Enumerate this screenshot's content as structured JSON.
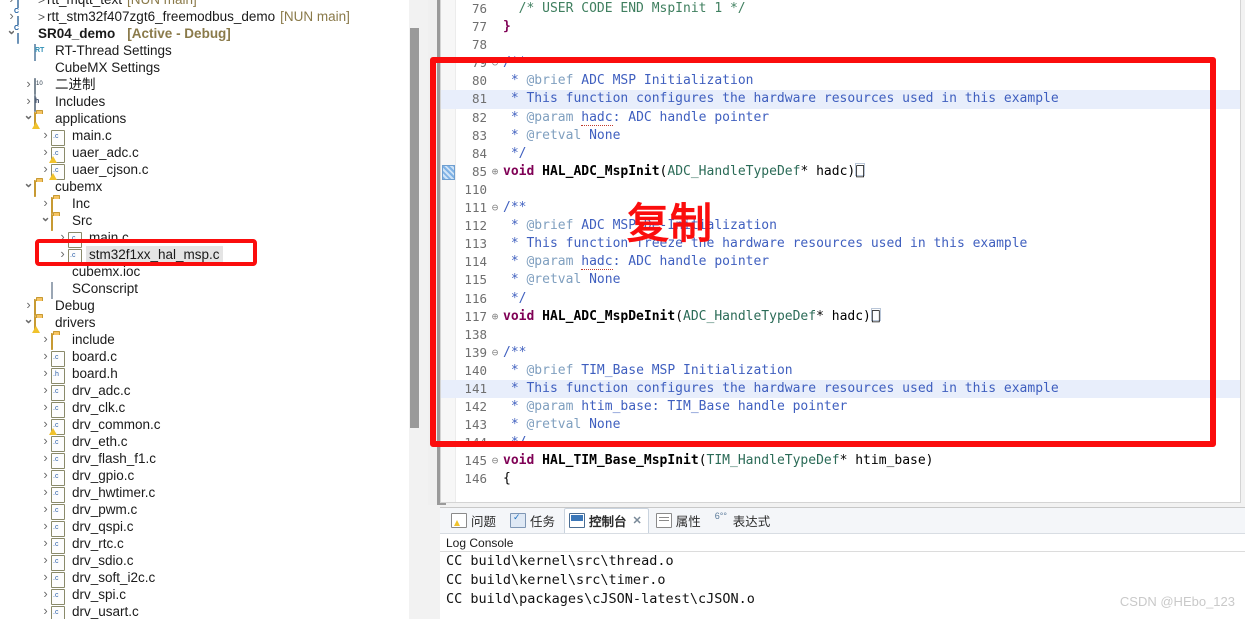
{
  "explorer": {
    "name": "project-explorer",
    "items": [
      {
        "indent": 0,
        "arrow": "closed",
        "icon": "project-c-icon",
        "gt": true,
        "label": "rtt_mqtt_text",
        "suffix": "[NUN main]",
        "clipped": true,
        "selected": false,
        "bold": false
      },
      {
        "indent": 0,
        "arrow": "closed",
        "icon": "project-c-icon",
        "gt": true,
        "label": "rtt_stm32f407zgt6_freemodbus_demo",
        "suffix": "[NUN main]",
        "selected": false,
        "bold": false
      },
      {
        "indent": 0,
        "arrow": "open",
        "icon": "project-c-icon",
        "gt": false,
        "label": "SR04_demo",
        "suffix": "[Active - Debug]",
        "selected": false,
        "bold": true
      },
      {
        "indent": 1,
        "arrow": "none",
        "icon": "rt-thread-icon",
        "gt": false,
        "label": "RT-Thread Settings",
        "suffix": "",
        "selected": false,
        "bold": false
      },
      {
        "indent": 1,
        "arrow": "none",
        "icon": "cubemx-icon",
        "gt": false,
        "label": "CubeMX Settings",
        "suffix": "",
        "selected": false,
        "bold": false
      },
      {
        "indent": 1,
        "arrow": "closed",
        "icon": "binary-icon",
        "gt": false,
        "label": "二进制",
        "suffix": "",
        "selected": false,
        "bold": false
      },
      {
        "indent": 1,
        "arrow": "closed",
        "icon": "includes-icon",
        "gt": false,
        "label": "Includes",
        "suffix": "",
        "selected": false,
        "bold": false
      },
      {
        "indent": 1,
        "arrow": "open",
        "icon": "folder-warn-icon",
        "gt": false,
        "label": "applications",
        "suffix": "",
        "selected": false,
        "bold": false
      },
      {
        "indent": 2,
        "arrow": "closed",
        "icon": "c-file-icon",
        "gt": false,
        "label": "main.c",
        "suffix": "",
        "selected": false,
        "bold": false
      },
      {
        "indent": 2,
        "arrow": "closed",
        "icon": "c-file-warn-icon",
        "gt": false,
        "label": "uaer_adc.c",
        "suffix": "",
        "selected": false,
        "bold": false
      },
      {
        "indent": 2,
        "arrow": "closed",
        "icon": "c-file-warn-icon",
        "gt": false,
        "label": "uaer_cjson.c",
        "suffix": "",
        "selected": false,
        "bold": false
      },
      {
        "indent": 1,
        "arrow": "open",
        "icon": "folder-icon",
        "gt": false,
        "label": "cubemx",
        "suffix": "",
        "selected": false,
        "bold": false
      },
      {
        "indent": 2,
        "arrow": "closed",
        "icon": "folder-icon",
        "gt": false,
        "label": "Inc",
        "suffix": "",
        "selected": false,
        "bold": false
      },
      {
        "indent": 2,
        "arrow": "open",
        "icon": "folder-icon",
        "gt": false,
        "label": "Src",
        "suffix": "",
        "selected": false,
        "bold": false
      },
      {
        "indent": 3,
        "arrow": "closed",
        "icon": "c-file-icon",
        "gt": false,
        "label": "main.c",
        "suffix": "",
        "selected": false,
        "bold": false
      },
      {
        "indent": 3,
        "arrow": "closed",
        "icon": "c-file-icon",
        "gt": false,
        "label": "stm32f1xx_hal_msp.c",
        "suffix": "",
        "selected": true,
        "bold": false
      },
      {
        "indent": 2,
        "arrow": "none",
        "icon": "cubemx-icon",
        "gt": false,
        "label": "cubemx.ioc",
        "suffix": "",
        "selected": false,
        "bold": false
      },
      {
        "indent": 2,
        "arrow": "none",
        "icon": "sconscript-icon",
        "gt": false,
        "label": "SConscript",
        "suffix": "",
        "selected": false,
        "bold": false
      },
      {
        "indent": 1,
        "arrow": "closed",
        "icon": "folder-icon",
        "gt": false,
        "label": "Debug",
        "suffix": "",
        "selected": false,
        "bold": false
      },
      {
        "indent": 1,
        "arrow": "open",
        "icon": "folder-warn-icon",
        "gt": false,
        "label": "drivers",
        "suffix": "",
        "selected": false,
        "bold": false
      },
      {
        "indent": 2,
        "arrow": "closed",
        "icon": "folder-icon",
        "gt": false,
        "label": "include",
        "suffix": "",
        "selected": false,
        "bold": false
      },
      {
        "indent": 2,
        "arrow": "closed",
        "icon": "c-file-icon",
        "gt": false,
        "label": "board.c",
        "suffix": "",
        "selected": false,
        "bold": false
      },
      {
        "indent": 2,
        "arrow": "closed",
        "icon": "h-file-icon",
        "gt": false,
        "label": "board.h",
        "suffix": "",
        "selected": false,
        "bold": false
      },
      {
        "indent": 2,
        "arrow": "closed",
        "icon": "c-file-icon",
        "gt": false,
        "label": "drv_adc.c",
        "suffix": "",
        "selected": false,
        "bold": false
      },
      {
        "indent": 2,
        "arrow": "closed",
        "icon": "c-file-icon",
        "gt": false,
        "label": "drv_clk.c",
        "suffix": "",
        "selected": false,
        "bold": false
      },
      {
        "indent": 2,
        "arrow": "closed",
        "icon": "c-file-warn-icon",
        "gt": false,
        "label": "drv_common.c",
        "suffix": "",
        "selected": false,
        "bold": false
      },
      {
        "indent": 2,
        "arrow": "closed",
        "icon": "c-file-icon",
        "gt": false,
        "label": "drv_eth.c",
        "suffix": "",
        "selected": false,
        "bold": false
      },
      {
        "indent": 2,
        "arrow": "closed",
        "icon": "c-file-icon",
        "gt": false,
        "label": "drv_flash_f1.c",
        "suffix": "",
        "selected": false,
        "bold": false
      },
      {
        "indent": 2,
        "arrow": "closed",
        "icon": "c-file-icon",
        "gt": false,
        "label": "drv_gpio.c",
        "suffix": "",
        "selected": false,
        "bold": false
      },
      {
        "indent": 2,
        "arrow": "closed",
        "icon": "c-file-icon",
        "gt": false,
        "label": "drv_hwtimer.c",
        "suffix": "",
        "selected": false,
        "bold": false
      },
      {
        "indent": 2,
        "arrow": "closed",
        "icon": "c-file-icon",
        "gt": false,
        "label": "drv_pwm.c",
        "suffix": "",
        "selected": false,
        "bold": false
      },
      {
        "indent": 2,
        "arrow": "closed",
        "icon": "c-file-icon",
        "gt": false,
        "label": "drv_qspi.c",
        "suffix": "",
        "selected": false,
        "bold": false
      },
      {
        "indent": 2,
        "arrow": "closed",
        "icon": "c-file-icon",
        "gt": false,
        "label": "drv_rtc.c",
        "suffix": "",
        "selected": false,
        "bold": false
      },
      {
        "indent": 2,
        "arrow": "closed",
        "icon": "c-file-icon",
        "gt": false,
        "label": "drv_sdio.c",
        "suffix": "",
        "selected": false,
        "bold": false
      },
      {
        "indent": 2,
        "arrow": "closed",
        "icon": "c-file-icon",
        "gt": false,
        "label": "drv_soft_i2c.c",
        "suffix": "",
        "selected": false,
        "bold": false
      },
      {
        "indent": 2,
        "arrow": "closed",
        "icon": "c-file-icon",
        "gt": false,
        "label": "drv_spi.c",
        "suffix": "",
        "selected": false,
        "bold": false
      },
      {
        "indent": 2,
        "arrow": "closed",
        "icon": "c-file-icon",
        "gt": false,
        "label": "drv_usart.c",
        "suffix": "",
        "selected": false,
        "bold": false
      }
    ]
  },
  "editor": {
    "name": "code-editor",
    "lines": [
      {
        "num": "76",
        "fold": "",
        "highlight": false,
        "bookmark": false,
        "segments": [
          {
            "t": "  /* USER CODE END MspInit 1 */",
            "c": "cmt"
          }
        ]
      },
      {
        "num": "77",
        "fold": "",
        "highlight": false,
        "bookmark": false,
        "segments": [
          {
            "t": "}",
            "c": "kw"
          }
        ]
      },
      {
        "num": "78",
        "fold": "",
        "highlight": false,
        "bookmark": false,
        "segments": [
          {
            "t": "",
            "c": "pl"
          }
        ]
      },
      {
        "num": "79",
        "fold": "⊖",
        "highlight": false,
        "bookmark": false,
        "segments": [
          {
            "t": "/**",
            "c": "jdoc"
          }
        ]
      },
      {
        "num": "80",
        "fold": "",
        "highlight": false,
        "bookmark": false,
        "segments": [
          {
            "t": " * ",
            "c": "jdoc"
          },
          {
            "t": "@brief",
            "c": "jtag"
          },
          {
            "t": " ADC MSP Initialization",
            "c": "jdoc"
          }
        ]
      },
      {
        "num": "81",
        "fold": "",
        "highlight": true,
        "bookmark": false,
        "segments": [
          {
            "t": " * This function configures the hardware resources used in this example",
            "c": "jdoc"
          }
        ]
      },
      {
        "num": "82",
        "fold": "",
        "highlight": false,
        "bookmark": false,
        "segments": [
          {
            "t": " * ",
            "c": "jdoc"
          },
          {
            "t": "@param",
            "c": "jtag"
          },
          {
            "t": " ",
            "c": "jdoc"
          },
          {
            "t": "hadc",
            "c": "jdoc squig"
          },
          {
            "t": ": ADC handle pointer",
            "c": "jdoc"
          }
        ]
      },
      {
        "num": "83",
        "fold": "",
        "highlight": false,
        "bookmark": false,
        "segments": [
          {
            "t": " * ",
            "c": "jdoc"
          },
          {
            "t": "@retval",
            "c": "jtag"
          },
          {
            "t": " None",
            "c": "jdoc"
          }
        ]
      },
      {
        "num": "84",
        "fold": "",
        "highlight": false,
        "bookmark": false,
        "segments": [
          {
            "t": " */",
            "c": "jdoc"
          }
        ]
      },
      {
        "num": "85",
        "fold": "⊕",
        "highlight": false,
        "bookmark": true,
        "segments": [
          {
            "t": "void",
            "c": "kw"
          },
          {
            "t": " ",
            "c": "pl"
          },
          {
            "t": "HAL_ADC_MspInit",
            "c": "fn"
          },
          {
            "t": "(",
            "c": "pl"
          },
          {
            "t": "ADC_HandleTypeDef",
            "c": "typ"
          },
          {
            "t": "* hadc)",
            "c": "pl"
          },
          {
            "t": "⎕",
            "c": "bx"
          }
        ]
      },
      {
        "num": "110",
        "fold": "",
        "highlight": false,
        "bookmark": false,
        "segments": [
          {
            "t": "",
            "c": "pl"
          }
        ]
      },
      {
        "num": "111",
        "fold": "⊖",
        "highlight": false,
        "bookmark": false,
        "segments": [
          {
            "t": "/**",
            "c": "jdoc"
          }
        ]
      },
      {
        "num": "112",
        "fold": "",
        "highlight": false,
        "bookmark": false,
        "segments": [
          {
            "t": " * ",
            "c": "jdoc"
          },
          {
            "t": "@brief",
            "c": "jtag"
          },
          {
            "t": " ADC MSP De-Initialization",
            "c": "jdoc"
          }
        ]
      },
      {
        "num": "113",
        "fold": "",
        "highlight": false,
        "bookmark": false,
        "segments": [
          {
            "t": " * This function freeze the hardware resources used in this example",
            "c": "jdoc"
          }
        ]
      },
      {
        "num": "114",
        "fold": "",
        "highlight": false,
        "bookmark": false,
        "segments": [
          {
            "t": " * ",
            "c": "jdoc"
          },
          {
            "t": "@param",
            "c": "jtag"
          },
          {
            "t": " ",
            "c": "jdoc"
          },
          {
            "t": "hadc",
            "c": "jdoc squig"
          },
          {
            "t": ": ADC handle pointer",
            "c": "jdoc"
          }
        ]
      },
      {
        "num": "115",
        "fold": "",
        "highlight": false,
        "bookmark": false,
        "segments": [
          {
            "t": " * ",
            "c": "jdoc"
          },
          {
            "t": "@retval",
            "c": "jtag"
          },
          {
            "t": " None",
            "c": "jdoc"
          }
        ]
      },
      {
        "num": "116",
        "fold": "",
        "highlight": false,
        "bookmark": false,
        "segments": [
          {
            "t": " */",
            "c": "jdoc"
          }
        ]
      },
      {
        "num": "117",
        "fold": "⊕",
        "highlight": false,
        "bookmark": false,
        "segments": [
          {
            "t": "void",
            "c": "kw"
          },
          {
            "t": " ",
            "c": "pl"
          },
          {
            "t": "HAL_ADC_MspDeInit",
            "c": "fn"
          },
          {
            "t": "(",
            "c": "pl"
          },
          {
            "t": "ADC_HandleTypeDef",
            "c": "typ"
          },
          {
            "t": "* hadc)",
            "c": "pl"
          },
          {
            "t": "⎕",
            "c": "bx"
          }
        ]
      },
      {
        "num": "138",
        "fold": "",
        "highlight": false,
        "bookmark": false,
        "segments": [
          {
            "t": "",
            "c": "pl"
          }
        ]
      },
      {
        "num": "139",
        "fold": "⊖",
        "highlight": false,
        "bookmark": false,
        "segments": [
          {
            "t": "/**",
            "c": "jdoc"
          }
        ]
      },
      {
        "num": "140",
        "fold": "",
        "highlight": false,
        "bookmark": false,
        "segments": [
          {
            "t": " * ",
            "c": "jdoc"
          },
          {
            "t": "@brief",
            "c": "jtag"
          },
          {
            "t": " TIM_Base MSP Initialization",
            "c": "jdoc"
          }
        ]
      },
      {
        "num": "141",
        "fold": "",
        "highlight": true,
        "bookmark": false,
        "segments": [
          {
            "t": " * This function configures the hardware resources used in this example",
            "c": "jdoc"
          }
        ]
      },
      {
        "num": "142",
        "fold": "",
        "highlight": false,
        "bookmark": false,
        "segments": [
          {
            "t": " * ",
            "c": "jdoc"
          },
          {
            "t": "@param",
            "c": "jtag"
          },
          {
            "t": " htim_base: TIM_Base handle pointer",
            "c": "jdoc"
          }
        ]
      },
      {
        "num": "143",
        "fold": "",
        "highlight": false,
        "bookmark": false,
        "segments": [
          {
            "t": " * ",
            "c": "jdoc"
          },
          {
            "t": "@retval",
            "c": "jtag"
          },
          {
            "t": " None",
            "c": "jdoc"
          }
        ]
      },
      {
        "num": "144",
        "fold": "",
        "highlight": false,
        "bookmark": false,
        "segments": [
          {
            "t": " */",
            "c": "jdoc"
          }
        ]
      },
      {
        "num": "145",
        "fold": "⊖",
        "highlight": false,
        "bookmark": false,
        "segments": [
          {
            "t": "void",
            "c": "kw"
          },
          {
            "t": " ",
            "c": "pl"
          },
          {
            "t": "HAL_TIM_Base_MspInit",
            "c": "fn"
          },
          {
            "t": "(",
            "c": "pl"
          },
          {
            "t": "TIM_HandleTypeDef",
            "c": "typ"
          },
          {
            "t": "* htim_base)",
            "c": "pl"
          }
        ]
      },
      {
        "num": "146",
        "fold": "",
        "highlight": false,
        "bookmark": false,
        "segments": [
          {
            "t": "{",
            "c": "pl"
          }
        ]
      }
    ]
  },
  "console": {
    "name": "console-panel",
    "tabs": [
      {
        "label": "问题",
        "icon": "problems-icon",
        "active": false,
        "closable": false
      },
      {
        "label": "任务",
        "icon": "tasks-icon",
        "active": false,
        "closable": false
      },
      {
        "label": "控制台",
        "icon": "console-icon",
        "active": true,
        "closable": true
      },
      {
        "label": "属性",
        "icon": "properties-icon",
        "active": false,
        "closable": false
      },
      {
        "label": "表达式",
        "icon": "expressions-icon",
        "active": false,
        "closable": false
      }
    ],
    "close_glyph": "✕",
    "title": "Log Console",
    "lines": [
      "CC build\\kernel\\src\\thread.o",
      "CC build\\kernel\\src\\timer.o",
      "CC build\\packages\\cJSON-latest\\cJSON.o"
    ]
  },
  "annotations": {
    "copy_label": "复制",
    "watermark": "CSDN @HEbo_123",
    "highlight_color": "#fb0d0d"
  }
}
